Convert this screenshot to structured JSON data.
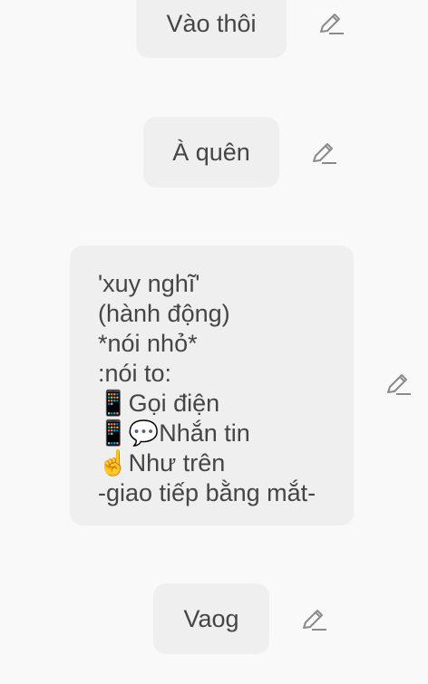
{
  "messages": [
    {
      "text": "Vào thôi"
    },
    {
      "text": "À quên"
    },
    {
      "lines": [
        "'xuy nghĩ'",
        "(hành động)",
        "*nói nhỏ*",
        ":nói to:",
        "📱Gọi điện",
        "📱💬Nhắn tin",
        "☝️Như trên",
        "-giao tiếp bằng mắt-"
      ]
    },
    {
      "text": "Vaog"
    }
  ],
  "icons": {
    "edit": "pencil-edit-icon"
  },
  "colors": {
    "background": "#f9f9f9",
    "bubble": "#efefef",
    "text": "#454545",
    "icon": "#8a8a8a"
  }
}
